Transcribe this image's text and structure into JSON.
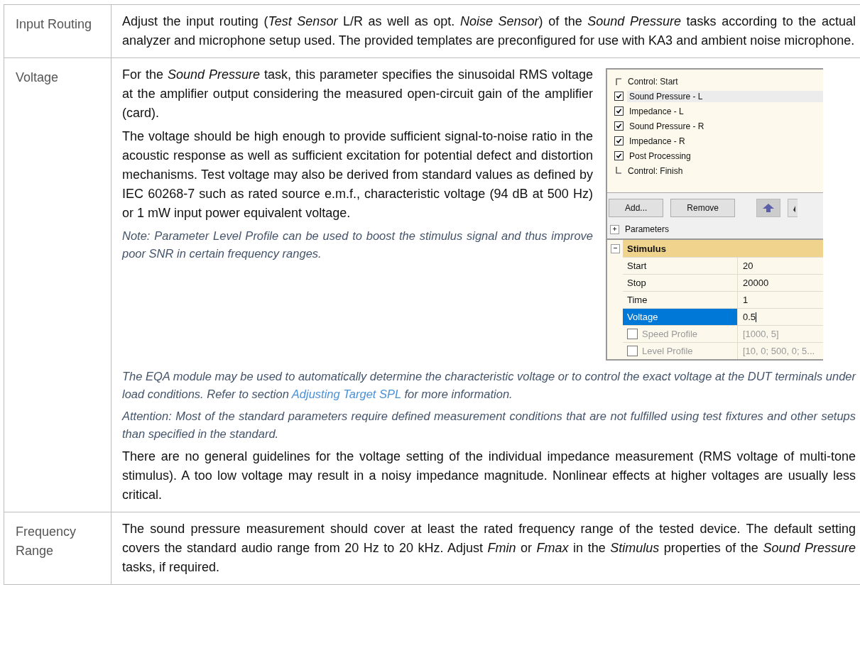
{
  "rows": [
    {
      "label": "Input Routing",
      "paragraphs": [
        {
          "kind": "body",
          "segments": [
            {
              "kind": "text",
              "text": "Adjust the input routing (*Test Sensor* L/R as well as opt. *Noise Sensor*) of the *Sound Pressure* tasks according to the actual analyzer and microphone setup used. The provided templates are preconfigured for use with KA3 and ambient noise microphone."
            }
          ]
        }
      ]
    },
    {
      "label": "Voltage",
      "screenshot": {
        "task_list": [
          {
            "kind": "start",
            "label": "Control: Start",
            "selected": false
          },
          {
            "kind": "check",
            "label": "Sound Pressure - L",
            "checked": true,
            "selected": true
          },
          {
            "kind": "check",
            "label": "Impedance - L",
            "checked": true,
            "selected": false
          },
          {
            "kind": "check",
            "label": "Sound Pressure - R",
            "checked": true,
            "selected": false
          },
          {
            "kind": "check",
            "label": "Impedance - R",
            "checked": true,
            "selected": false
          },
          {
            "kind": "check",
            "label": "Post Processing",
            "checked": true,
            "selected": false
          },
          {
            "kind": "end",
            "label": "Control: Finish",
            "selected": false
          }
        ],
        "buttons": [
          "Add...",
          "Remove"
        ],
        "parameters": {
          "label": "Parameters",
          "expanded": false
        },
        "property_group": {
          "label": "Stimulus",
          "expanded": true,
          "rows": [
            {
              "kind": "plain",
              "name": "Start",
              "value": "20",
              "selected": false,
              "disabled": false
            },
            {
              "kind": "plain",
              "name": "Stop",
              "value": "20000",
              "selected": false,
              "disabled": false
            },
            {
              "kind": "plain",
              "name": "Time",
              "value": "1",
              "selected": false,
              "disabled": false
            },
            {
              "kind": "plain",
              "name": "Voltage",
              "value": "0.5",
              "selected": true,
              "disabled": false
            },
            {
              "kind": "checkbox",
              "name": "Speed Profile",
              "value": "[1000, 5]",
              "checked": false,
              "selected": false,
              "disabled": true
            },
            {
              "kind": "checkbox",
              "name": "Level Profile",
              "value": "[10, 0; 500, 0; 5...",
              "checked": false,
              "selected": false,
              "disabled": true
            }
          ]
        }
      },
      "side_paragraphs": [
        {
          "kind": "body",
          "segments": [
            {
              "kind": "text",
              "text": "For the *Sound Pressure* task, this parameter specifies the sinusoidal RMS voltage at the amplifier output considering the measured open-circuit gain of the amplifier (card)."
            }
          ]
        },
        {
          "kind": "body",
          "segments": [
            {
              "kind": "text",
              "text": "The voltage should be high enough to provide sufficient signal-to-noise ratio in the acoustic response as well as sufficient excitation for potential defect and distortion mechanisms. Test voltage may also be derived from standard values as defined by IEC 60268-7 such as rated source e.m.f., characteristic voltage (94 dB at 500 Hz) or 1 mW input power equivalent voltage."
            }
          ]
        },
        {
          "kind": "note",
          "segments": [
            {
              "kind": "text",
              "text": "Note: Parameter Level Profile can be used to boost the stimulus signal and thus improve poor SNR in certain frequency ranges."
            }
          ]
        }
      ],
      "paragraphs": [
        {
          "kind": "note",
          "segments": [
            {
              "kind": "text",
              "text": "The EQA module may be used to automatically determine the characteristic voltage or to control the exact voltage at the DUT terminals under load conditions. Refer to section "
            },
            {
              "kind": "link",
              "text": "Adjusting Target SPL"
            },
            {
              "kind": "text",
              "text": " for more information."
            }
          ]
        },
        {
          "kind": "note",
          "segments": [
            {
              "kind": "text",
              "text": "Attention: Most of the standard parameters require defined measurement conditions that are not fulfilled using test fixtures and other setups than specified in the standard."
            }
          ]
        },
        {
          "kind": "body",
          "segments": [
            {
              "kind": "text",
              "text": "There are no general guidelines for the voltage setting of the individual impedance measurement (RMS voltage of multi-tone stimulus). A too low voltage may result in a noisy impedance magnitude. Nonlinear effects at higher voltages are usually less critical."
            }
          ]
        }
      ]
    },
    {
      "label": "Frequency Range",
      "paragraphs": [
        {
          "kind": "body",
          "segments": [
            {
              "kind": "text",
              "text": "The sound pressure measurement should cover at least the rated frequency range of the tested device. The default setting covers the standard audio range from 20 Hz to 20 kHz. Adjust *Fmin* or *Fmax* in the *Stimulus* properties of the *Sound Pressure* tasks, if required."
            }
          ]
        }
      ]
    }
  ]
}
